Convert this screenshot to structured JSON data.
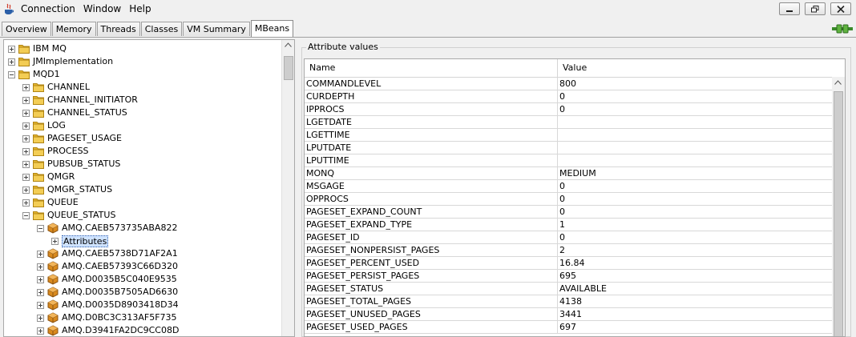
{
  "menu": [
    "Connection",
    "Window",
    "Help"
  ],
  "tabs": [
    "Overview",
    "Memory",
    "Threads",
    "Classes",
    "VM Summary",
    "MBeans"
  ],
  "active_tab": "MBeans",
  "tree": [
    {
      "label": "IBM MQ",
      "level": 0,
      "type": "folder",
      "expander": "plus"
    },
    {
      "label": "JMImplementation",
      "level": 0,
      "type": "folder",
      "expander": "plus"
    },
    {
      "label": "MQD1",
      "level": 0,
      "type": "folder",
      "expander": "minus"
    },
    {
      "label": "CHANNEL",
      "level": 1,
      "type": "folder",
      "expander": "plus"
    },
    {
      "label": "CHANNEL_INITIATOR",
      "level": 1,
      "type": "folder",
      "expander": "plus"
    },
    {
      "label": "CHANNEL_STATUS",
      "level": 1,
      "type": "folder",
      "expander": "plus"
    },
    {
      "label": "LOG",
      "level": 1,
      "type": "folder",
      "expander": "plus"
    },
    {
      "label": "PAGESET_USAGE",
      "level": 1,
      "type": "folder",
      "expander": "plus"
    },
    {
      "label": "PROCESS",
      "level": 1,
      "type": "folder",
      "expander": "plus"
    },
    {
      "label": "PUBSUB_STATUS",
      "level": 1,
      "type": "folder",
      "expander": "plus"
    },
    {
      "label": "QMGR",
      "level": 1,
      "type": "folder",
      "expander": "plus"
    },
    {
      "label": "QMGR_STATUS",
      "level": 1,
      "type": "folder",
      "expander": "plus"
    },
    {
      "label": "QUEUE",
      "level": 1,
      "type": "folder",
      "expander": "plus"
    },
    {
      "label": "QUEUE_STATUS",
      "level": 1,
      "type": "folder",
      "expander": "minus"
    },
    {
      "label": "AMQ.CAEB573735ABA822",
      "level": 2,
      "type": "bean",
      "expander": "minus"
    },
    {
      "label": "Attributes",
      "level": 3,
      "type": "none",
      "expander": "plus",
      "selected": true
    },
    {
      "label": "AMQ.CAEB5738D71AF2A1",
      "level": 2,
      "type": "bean",
      "expander": "plus"
    },
    {
      "label": "AMQ.CAEB57393C66D320",
      "level": 2,
      "type": "bean",
      "expander": "plus"
    },
    {
      "label": "AMQ.D0035B5C040E9535",
      "level": 2,
      "type": "bean",
      "expander": "plus"
    },
    {
      "label": "AMQ.D0035B7505AD6630",
      "level": 2,
      "type": "bean",
      "expander": "plus"
    },
    {
      "label": "AMQ.D0035D8903418D34",
      "level": 2,
      "type": "bean",
      "expander": "plus"
    },
    {
      "label": "AMQ.D0BC3C313AF5F735",
      "level": 2,
      "type": "bean",
      "expander": "plus"
    },
    {
      "label": "AMQ.D3941FA2DC9CC08D",
      "level": 2,
      "type": "bean",
      "expander": "plus"
    }
  ],
  "attributes": {
    "title": "Attribute values",
    "col_name": "Name",
    "col_value": "Value",
    "rows": [
      [
        "COMMANDLEVEL",
        "800"
      ],
      [
        "CURDEPTH",
        "0"
      ],
      [
        "IPPROCS",
        "0"
      ],
      [
        "LGETDATE",
        ""
      ],
      [
        "LGETTIME",
        ""
      ],
      [
        "LPUTDATE",
        ""
      ],
      [
        "LPUTTIME",
        ""
      ],
      [
        "MONQ",
        "MEDIUM"
      ],
      [
        "MSGAGE",
        "0"
      ],
      [
        "OPPROCS",
        "0"
      ],
      [
        "PAGESET_EXPAND_COUNT",
        "0"
      ],
      [
        "PAGESET_EXPAND_TYPE",
        "1"
      ],
      [
        "PAGESET_ID",
        "0"
      ],
      [
        "PAGESET_NONPERSIST_PAGES",
        "2"
      ],
      [
        "PAGESET_PERCENT_USED",
        "16.84"
      ],
      [
        "PAGESET_PERSIST_PAGES",
        "695"
      ],
      [
        "PAGESET_STATUS",
        "AVAILABLE"
      ],
      [
        "PAGESET_TOTAL_PAGES",
        "4138"
      ],
      [
        "PAGESET_UNUSED_PAGES",
        "3441"
      ],
      [
        "PAGESET_USED_PAGES",
        "697"
      ]
    ]
  },
  "colors": {
    "folder": "#e8b830",
    "bean": "#d98a1e",
    "selection": "#cfe3ff"
  }
}
